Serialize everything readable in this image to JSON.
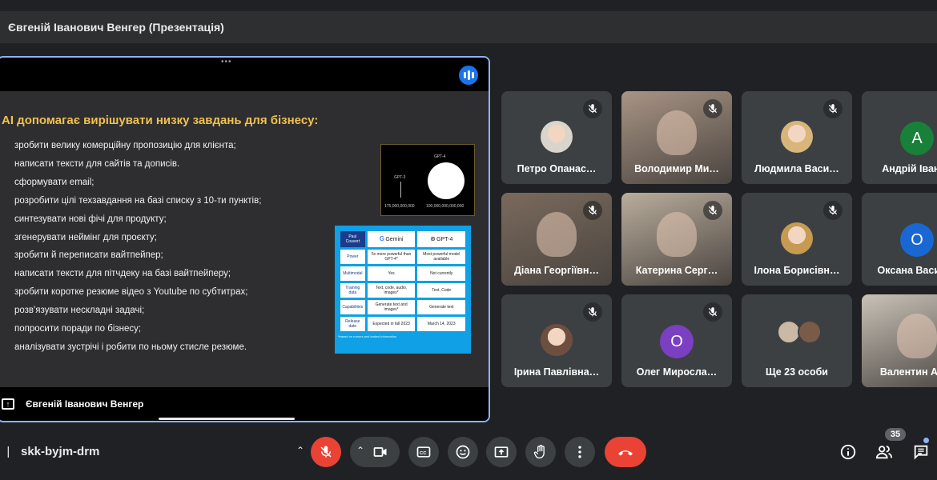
{
  "header": {
    "title": "Євгеній Іванович Венгер (Презентація)"
  },
  "slide": {
    "title": "AI допомагає вирішувати низку завдань для бізнесу:",
    "bullets": [
      "зробити велику комерційну пропозицію для клієнта;",
      "написати тексти для сайтів та дописів.",
      "сформувати email;",
      "розробити цілі техзавдання на базі списку з 10-ти пунктів;",
      "синтезувати нові фічі для продукту;",
      "згенерувати неймінг для проєкту;",
      "зробити й переписати вайтпейпер;",
      "написати тексти для пітчдеку на базі вайтпейперу;",
      "зробити коротке резюме відео з Youtube по субтитрах;",
      "розв'язувати нескладні задачі;",
      "попросити поради по бізнесу;",
      "аналізувати зустрічі і робити по ньому стисле резюме."
    ],
    "gpt_chart": {
      "gpt3_label": "GPT-3",
      "gpt4_label": "GPT-4",
      "gpt3_value": "175,000,000,000",
      "gpt4_value": "100,000,000,000,000"
    },
    "comparison": {
      "header": [
        "Paul Couvert",
        "Gemini",
        "GPT-4"
      ],
      "rows": [
        [
          "Power",
          "5x more powerful than GPT-4*",
          "Most powerful model available"
        ],
        [
          "Multimodal",
          "Yes",
          "Not currently"
        ],
        [
          "Training data",
          "Text, code, audio, images*",
          "Text, Code"
        ],
        [
          "Capabilities",
          "Generate text and images*",
          "Generate text"
        ],
        [
          "Release date",
          "Expected in fall 2023",
          "March 14, 2023"
        ]
      ],
      "footnote": "*based on rumors and leaked information"
    }
  },
  "presenter": {
    "name": "Євгеній Іванович Венгер"
  },
  "participants": [
    {
      "name": "Петро Опанас…",
      "muted": true,
      "kind": "photo",
      "color": "#d9d4cc"
    },
    {
      "name": "Володимир Ми…",
      "muted": true,
      "kind": "video",
      "color": "#a89484"
    },
    {
      "name": "Людмила Васи…",
      "muted": true,
      "kind": "photo",
      "color": "#d8b67a"
    },
    {
      "name": "Андрій Іванов",
      "muted": false,
      "kind": "letter",
      "letter": "A",
      "color": "#188038"
    },
    {
      "name": "Діана Георгіївн…",
      "muted": true,
      "kind": "video",
      "color": "#7a6a5c"
    },
    {
      "name": "Катерина Серг…",
      "muted": true,
      "kind": "video",
      "color": "#b9ad9c"
    },
    {
      "name": "Ілона Борисівн…",
      "muted": true,
      "kind": "photo",
      "color": "#c79a52"
    },
    {
      "name": "Оксана Васил…",
      "muted": false,
      "kind": "letter",
      "letter": "O",
      "color": "#1967d2"
    },
    {
      "name": "Ірина Павлівна…",
      "muted": true,
      "kind": "photo",
      "color": "#6e4f3f"
    },
    {
      "name": "Олег Миросла…",
      "muted": true,
      "kind": "letter",
      "letter": "O",
      "color": "#7b3fc2"
    },
    {
      "name": "Ще 23 особи",
      "muted": false,
      "kind": "group",
      "color": "#3c4043"
    },
    {
      "name": "Валентин Ан…",
      "muted": false,
      "kind": "video",
      "color": "#c8c2b8"
    }
  ],
  "meeting": {
    "code": "skk-byjm-drm",
    "participant_count": "35"
  },
  "controls": {
    "mic": "mic-off-icon",
    "camera": "camera-icon",
    "captions": "captions-icon",
    "reactions": "emoji-icon",
    "present": "present-icon",
    "hand": "raise-hand-icon",
    "more": "more-icon",
    "leave": "hang-up-icon"
  }
}
